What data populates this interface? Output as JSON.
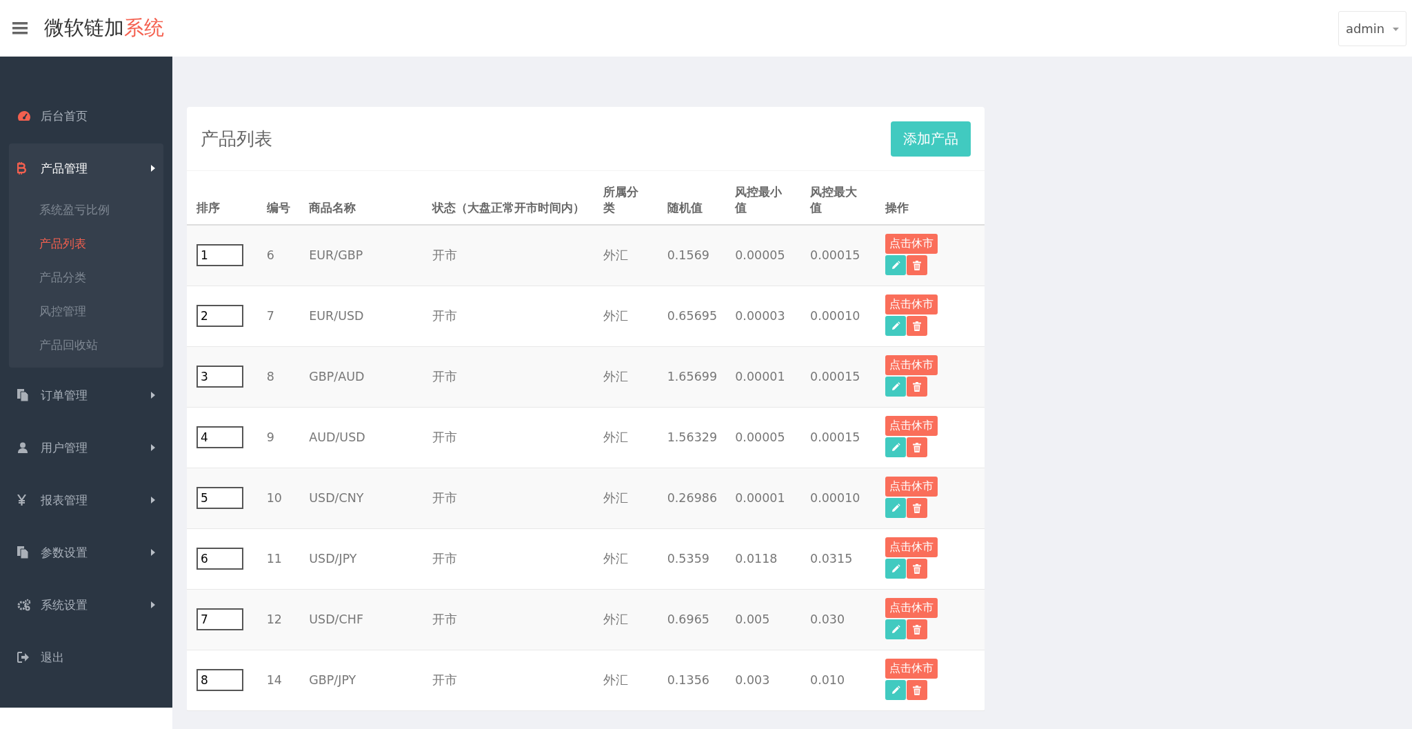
{
  "header": {
    "brand_main": "微软链加",
    "brand_accent": "系统",
    "user_menu": "admin"
  },
  "sidebar": {
    "items": [
      {
        "label": "后台首页"
      },
      {
        "label": "产品管理",
        "expanded": true,
        "children": [
          {
            "label": "系统盈亏比例",
            "selected": false
          },
          {
            "label": "产品列表",
            "selected": true
          },
          {
            "label": "产品分类",
            "selected": false
          },
          {
            "label": "风控管理",
            "selected": false
          },
          {
            "label": "产品回收站",
            "selected": false
          }
        ]
      },
      {
        "label": "订单管理",
        "expanded": false
      },
      {
        "label": "用户管理",
        "expanded": false
      },
      {
        "label": "报表管理",
        "expanded": false
      },
      {
        "label": "参数设置",
        "expanded": false
      },
      {
        "label": "系统设置",
        "expanded": false
      },
      {
        "label": "退出"
      }
    ]
  },
  "card": {
    "title": "产品列表",
    "add_button": "添加产品"
  },
  "table": {
    "columns": [
      "排序",
      "编号",
      "商品名称",
      "状态（大盘正常开市时间内）",
      "所属分类",
      "随机值",
      "风控最小值",
      "风控最大值",
      "操作"
    ],
    "rows": [
      {
        "order": "1",
        "id": "6",
        "name": "EUR/GBP",
        "status": "开市",
        "category": "外汇",
        "random": "0.1569",
        "risk_min": "0.00005",
        "risk_max": "0.00015",
        "action": "点击休市"
      },
      {
        "order": "2",
        "id": "7",
        "name": "EUR/USD",
        "status": "开市",
        "category": "外汇",
        "random": "0.65695",
        "risk_min": "0.00003",
        "risk_max": "0.00010",
        "action": "点击休市"
      },
      {
        "order": "3",
        "id": "8",
        "name": "GBP/AUD",
        "status": "开市",
        "category": "外汇",
        "random": "1.65699",
        "risk_min": "0.00001",
        "risk_max": "0.00015",
        "action": "点击休市"
      },
      {
        "order": "4",
        "id": "9",
        "name": "AUD/USD",
        "status": "开市",
        "category": "外汇",
        "random": "1.56329",
        "risk_min": "0.00005",
        "risk_max": "0.00015",
        "action": "点击休市"
      },
      {
        "order": "5",
        "id": "10",
        "name": "USD/CNY",
        "status": "开市",
        "category": "外汇",
        "random": "0.26986",
        "risk_min": "0.00001",
        "risk_max": "0.00010",
        "action": "点击休市"
      },
      {
        "order": "6",
        "id": "11",
        "name": "USD/JPY",
        "status": "开市",
        "category": "外汇",
        "random": "0.5359",
        "risk_min": "0.0118",
        "risk_max": "0.0315",
        "action": "点击休市"
      },
      {
        "order": "7",
        "id": "12",
        "name": "USD/CHF",
        "status": "开市",
        "category": "外汇",
        "random": "0.6965",
        "risk_min": "0.005",
        "risk_max": "0.030",
        "action": "点击休市"
      },
      {
        "order": "8",
        "id": "14",
        "name": "GBP/JPY",
        "status": "开市",
        "category": "外汇",
        "random": "0.1356",
        "risk_min": "0.003",
        "risk_max": "0.010",
        "action": "点击休市"
      }
    ]
  }
}
